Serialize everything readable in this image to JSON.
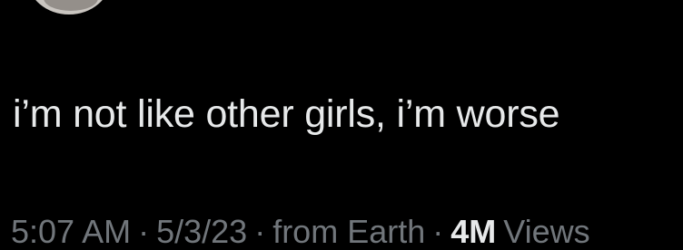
{
  "tweet": {
    "text": "i’m not like other girls, i’m worse"
  },
  "meta": {
    "time": "5:07 AM",
    "separator": "·",
    "date": "5/3/23",
    "source": "from Earth",
    "views_count": "4M",
    "views_label": "Views"
  },
  "colors": {
    "background": "#000000",
    "text_primary": "#e7e9ea",
    "text_secondary": "#71767b"
  }
}
